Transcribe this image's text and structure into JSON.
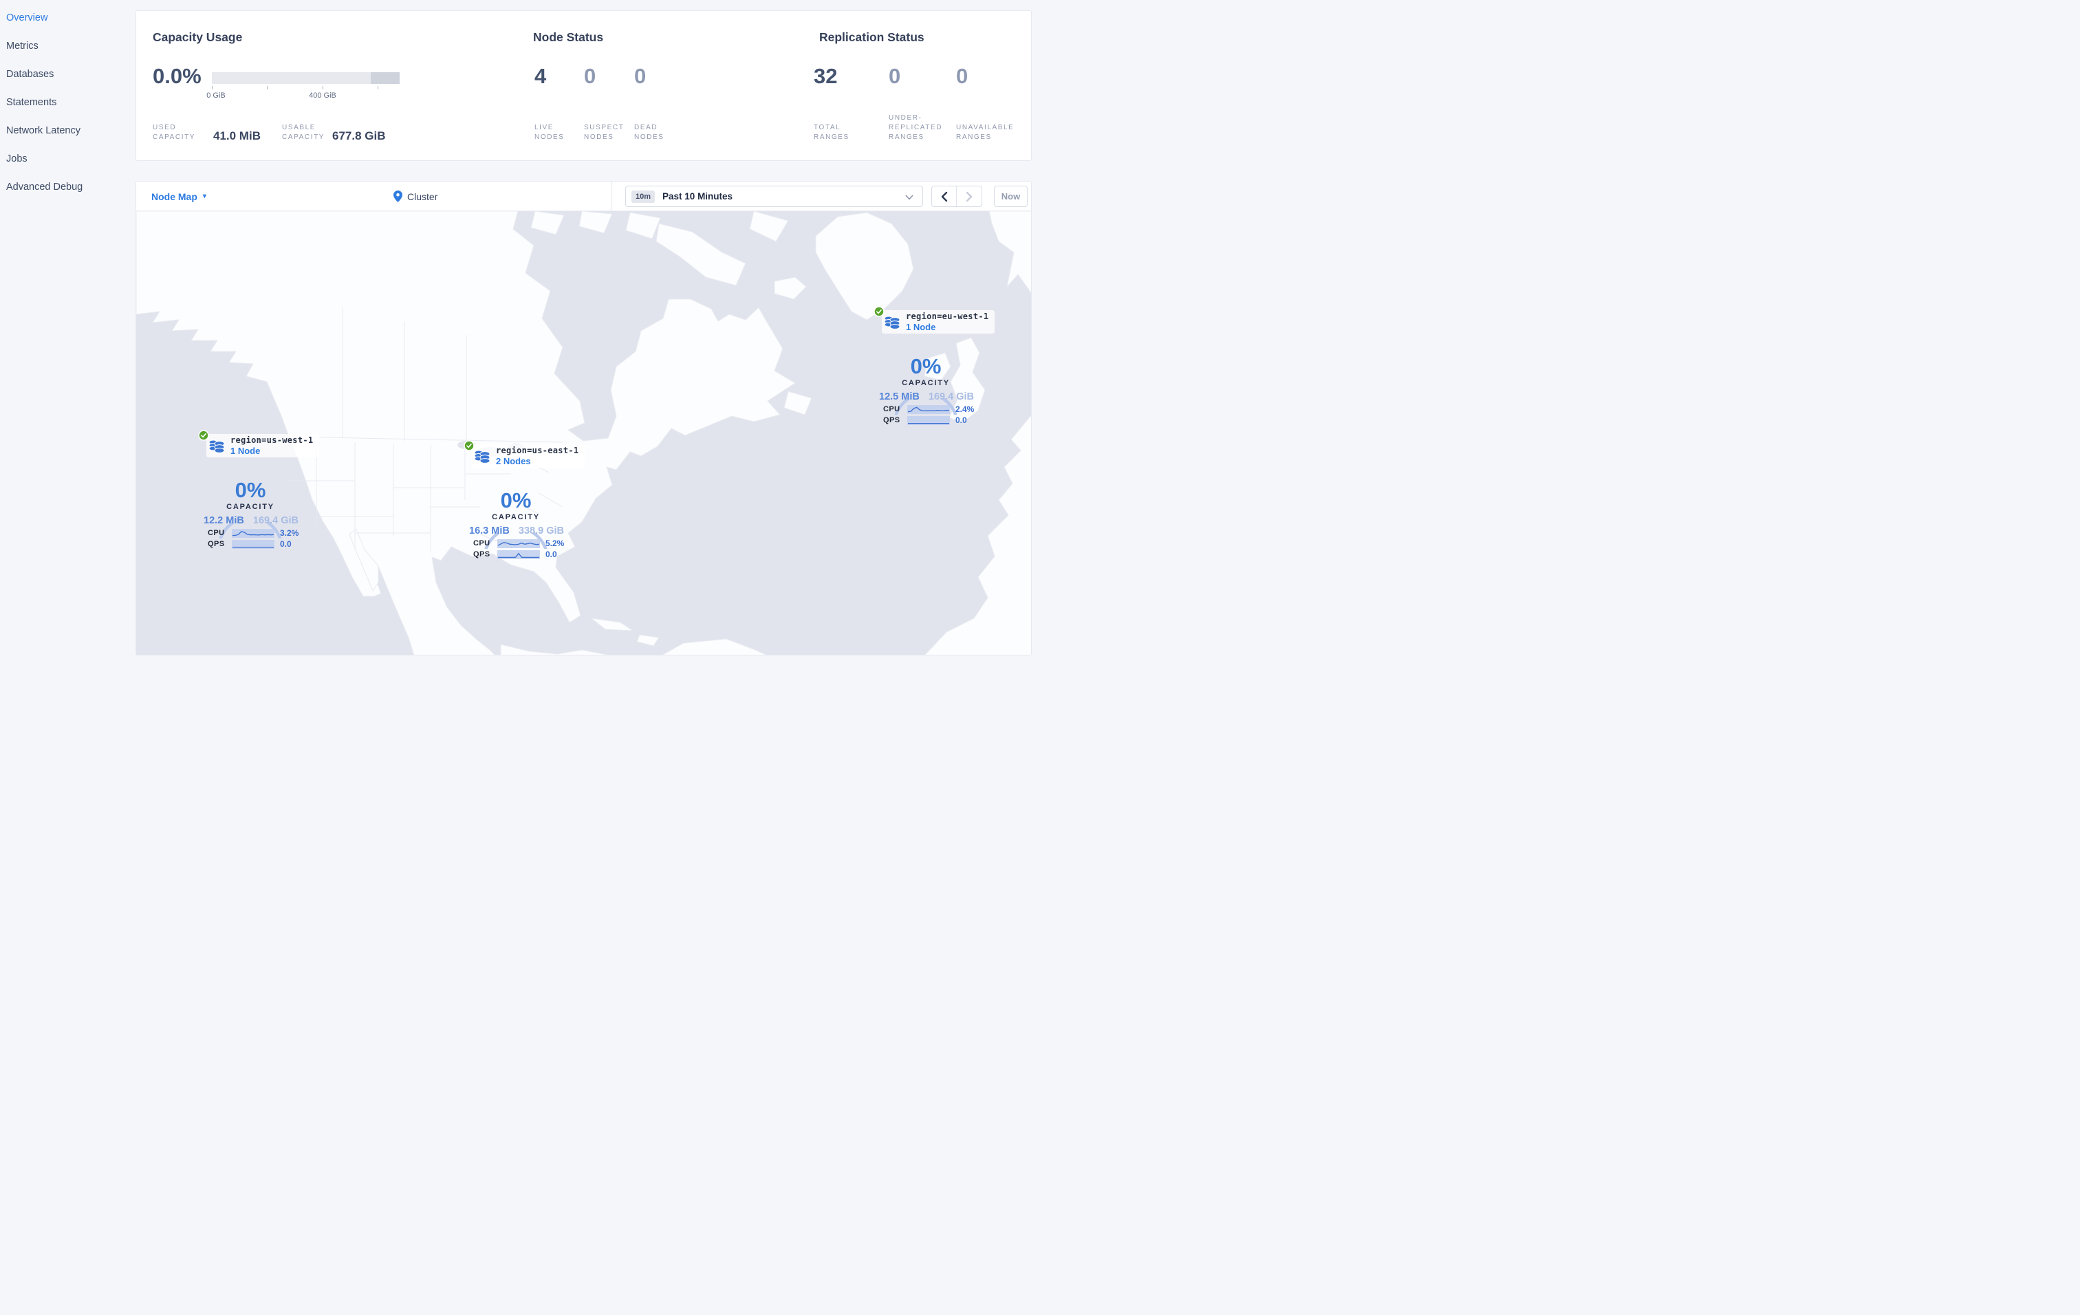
{
  "sidebar": {
    "items": [
      {
        "label": "Overview",
        "active": true
      },
      {
        "label": "Metrics",
        "active": false
      },
      {
        "label": "Databases",
        "active": false
      },
      {
        "label": "Statements",
        "active": false
      },
      {
        "label": "Network Latency",
        "active": false
      },
      {
        "label": "Jobs",
        "active": false
      },
      {
        "label": "Advanced Debug",
        "active": false
      }
    ]
  },
  "summary": {
    "capacity": {
      "title": "Capacity Usage",
      "percent": "0.0%",
      "tick_labels": [
        "0 GiB",
        "400 GiB"
      ],
      "used_label": "USED CAPACITY",
      "used_value": "41.0 MiB",
      "usable_label": "USABLE CAPACITY",
      "usable_value": "677.8 GiB"
    },
    "node_status": {
      "title": "Node Status",
      "stats": [
        {
          "value": "4",
          "label": "LIVE NODES"
        },
        {
          "value": "0",
          "label": "SUSPECT NODES"
        },
        {
          "value": "0",
          "label": "DEAD NODES"
        }
      ]
    },
    "replication_status": {
      "title": "Replication Status",
      "stats": [
        {
          "value": "32",
          "label": "TOTAL RANGES"
        },
        {
          "value": "0",
          "label": "UNDER-REPLICATED RANGES"
        },
        {
          "value": "0",
          "label": "UNAVAILABLE RANGES"
        }
      ]
    }
  },
  "toolbar": {
    "view_selector": "Node Map",
    "breadcrumb": "Cluster",
    "time_badge": "10m",
    "time_label": "Past 10 Minutes",
    "now_label": "Now"
  },
  "map": {
    "regions": [
      {
        "name": "region=us-west-1",
        "nodes": "1 Node",
        "percent": "0%",
        "capacity_label": "CAPACITY",
        "used": "12.2 MiB",
        "usable": "169.4 GiB",
        "cpu_label": "CPU",
        "cpu_value": "3.2%",
        "qps_label": "QPS",
        "qps_value": "0.0",
        "cpu_spark": [
          0.2,
          0.22,
          0.35,
          0.82,
          0.7,
          0.38,
          0.3,
          0.32,
          0.3,
          0.28,
          0.33,
          0.3,
          0.34,
          0.3,
          0.33
        ],
        "qps_spark": [
          0.1,
          0.1,
          0.1,
          0.1,
          0.1,
          0.1,
          0.1,
          0.1,
          0.1,
          0.1,
          0.1,
          0.1,
          0.1,
          0.1,
          0.1
        ]
      },
      {
        "name": "region=us-east-1",
        "nodes": "2 Nodes",
        "percent": "0%",
        "capacity_label": "CAPACITY",
        "used": "16.3 MiB",
        "usable": "338.9 GiB",
        "cpu_label": "CPU",
        "cpu_value": "5.2%",
        "qps_label": "QPS",
        "qps_value": "0.0",
        "cpu_spark": [
          0.25,
          0.5,
          0.72,
          0.62,
          0.45,
          0.4,
          0.38,
          0.44,
          0.62,
          0.45,
          0.52,
          0.62,
          0.48,
          0.4,
          0.44
        ],
        "qps_spark": [
          0.12,
          0.12,
          0.12,
          0.12,
          0.12,
          0.12,
          0.14,
          0.72,
          0.14,
          0.12,
          0.12,
          0.12,
          0.12,
          0.12,
          0.12
        ]
      },
      {
        "name": "region=eu-west-1",
        "nodes": "1 Node",
        "percent": "0%",
        "capacity_label": "CAPACITY",
        "used": "12.5 MiB",
        "usable": "169.4 GiB",
        "cpu_label": "CPU",
        "cpu_value": "2.4%",
        "qps_label": "QPS",
        "qps_value": "0.0",
        "cpu_spark": [
          0.2,
          0.25,
          0.72,
          0.85,
          0.48,
          0.36,
          0.34,
          0.36,
          0.34,
          0.37,
          0.42,
          0.38,
          0.36,
          0.42,
          0.4
        ],
        "qps_spark": [
          0.1,
          0.1,
          0.1,
          0.1,
          0.1,
          0.1,
          0.1,
          0.1,
          0.1,
          0.1,
          0.1,
          0.1,
          0.1,
          0.1,
          0.1
        ]
      }
    ]
  },
  "colors": {
    "accent_blue": "#2f7ce0",
    "gauge_blue": "#3a7bd5",
    "gauge_arc": "#b9c9ec",
    "spark_line": "#3a6fd0",
    "spark_band": "#bfcfee",
    "status_green": "#57a42c",
    "ocean": "#e2e4ed",
    "land": "#fcfdfe",
    "primary_text": "#36415a",
    "dim_number": "#8d98b2"
  }
}
